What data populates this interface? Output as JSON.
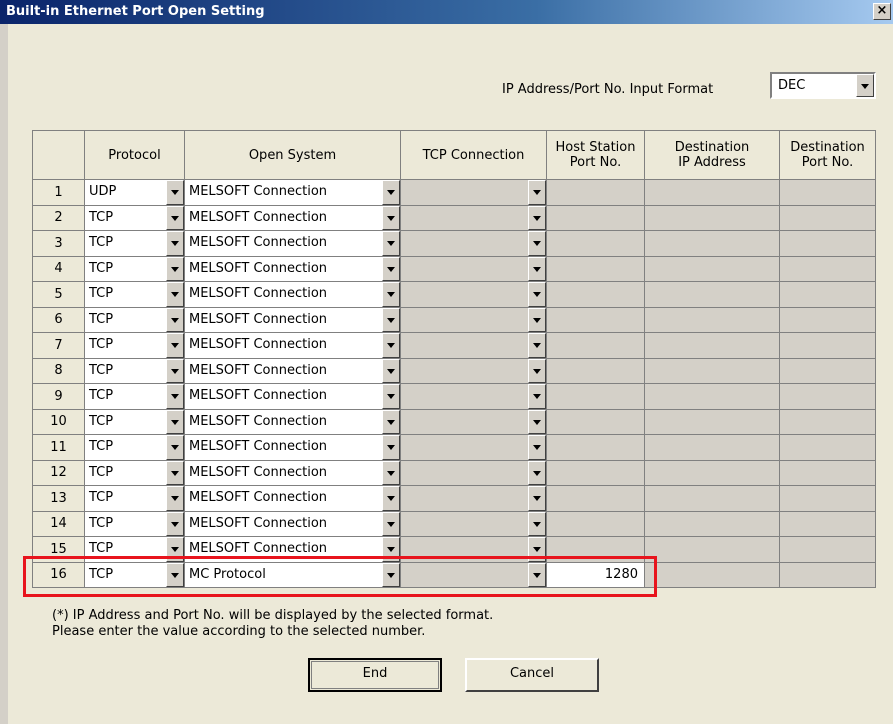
{
  "title": "Built-in Ethernet Port Open Setting",
  "close_label": "×",
  "input_format": {
    "label": "IP Address/Port No. Input Format",
    "value": "DEC"
  },
  "columns": {
    "protocol": "Protocol",
    "open_system": "Open System",
    "tcp_connection": "TCP Connection",
    "host_port_1": "Host Station",
    "host_port_2": "Port No.",
    "dest_ip_1": "Destination",
    "dest_ip_2": "IP Address",
    "dest_port_1": "Destination",
    "dest_port_2": "Port No."
  },
  "rows": [
    {
      "num": "1",
      "protocol": "UDP",
      "open_system": "MELSOFT Connection",
      "host_port": ""
    },
    {
      "num": "2",
      "protocol": "TCP",
      "open_system": "MELSOFT Connection",
      "host_port": ""
    },
    {
      "num": "3",
      "protocol": "TCP",
      "open_system": "MELSOFT Connection",
      "host_port": ""
    },
    {
      "num": "4",
      "protocol": "TCP",
      "open_system": "MELSOFT Connection",
      "host_port": ""
    },
    {
      "num": "5",
      "protocol": "TCP",
      "open_system": "MELSOFT Connection",
      "host_port": ""
    },
    {
      "num": "6",
      "protocol": "TCP",
      "open_system": "MELSOFT Connection",
      "host_port": ""
    },
    {
      "num": "7",
      "protocol": "TCP",
      "open_system": "MELSOFT Connection",
      "host_port": ""
    },
    {
      "num": "8",
      "protocol": "TCP",
      "open_system": "MELSOFT Connection",
      "host_port": ""
    },
    {
      "num": "9",
      "protocol": "TCP",
      "open_system": "MELSOFT Connection",
      "host_port": ""
    },
    {
      "num": "10",
      "protocol": "TCP",
      "open_system": "MELSOFT Connection",
      "host_port": ""
    },
    {
      "num": "11",
      "protocol": "TCP",
      "open_system": "MELSOFT Connection",
      "host_port": ""
    },
    {
      "num": "12",
      "protocol": "TCP",
      "open_system": "MELSOFT Connection",
      "host_port": ""
    },
    {
      "num": "13",
      "protocol": "TCP",
      "open_system": "MELSOFT Connection",
      "host_port": ""
    },
    {
      "num": "14",
      "protocol": "TCP",
      "open_system": "MELSOFT Connection",
      "host_port": ""
    },
    {
      "num": "15",
      "protocol": "TCP",
      "open_system": "MELSOFT Connection",
      "host_port": ""
    },
    {
      "num": "16",
      "protocol": "TCP",
      "open_system": "MC Protocol",
      "host_port": "1280"
    }
  ],
  "note_line1": "(*) IP Address and Port No. will be displayed by the selected format.",
  "note_line2": "Please enter the value according to the selected number.",
  "end_label": "End",
  "cancel_label": "Cancel",
  "colors": {
    "highlight": "#e8141d",
    "titlebar": "#0a246a",
    "disabled_cell": "#d4d0c8"
  }
}
